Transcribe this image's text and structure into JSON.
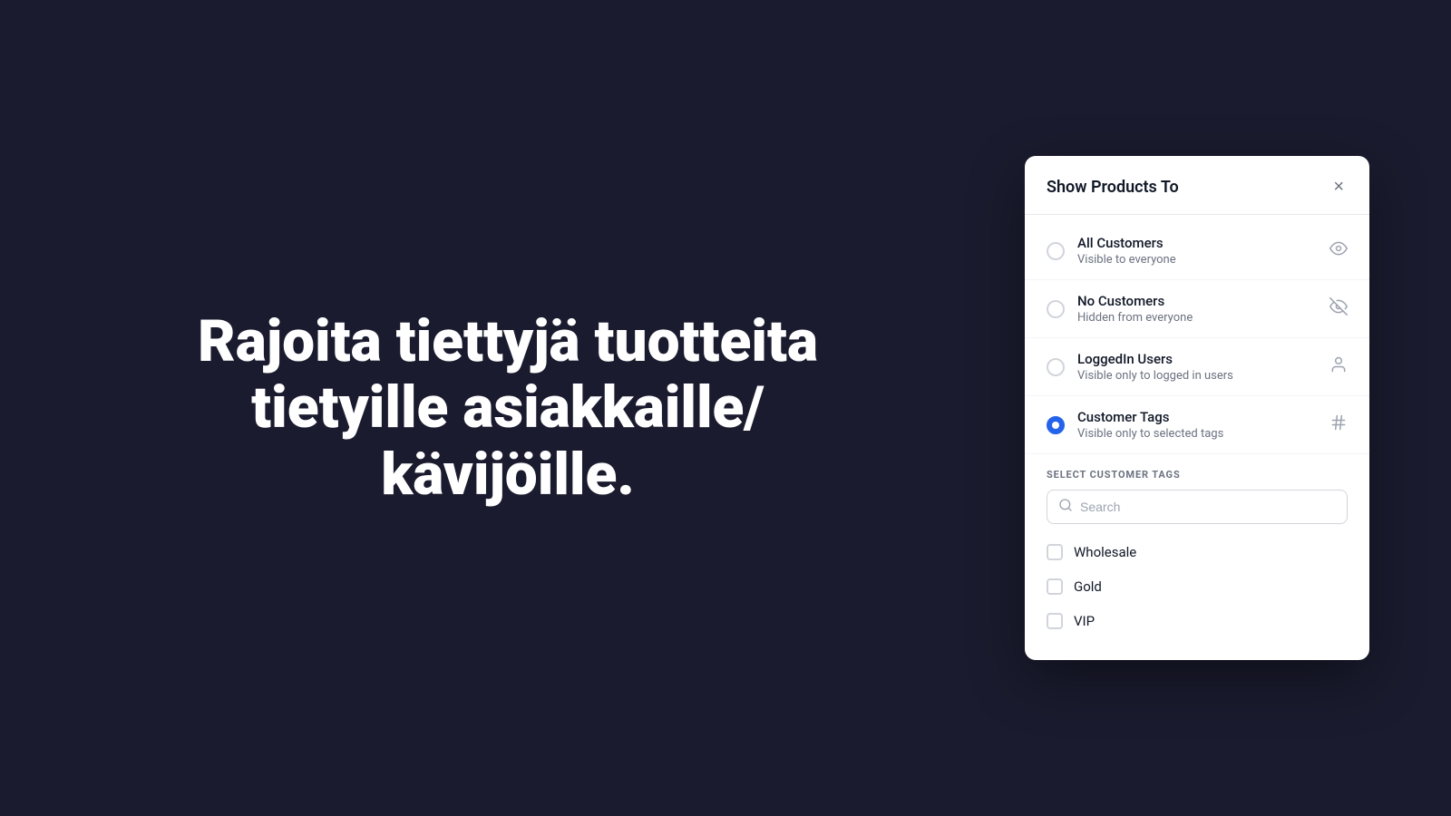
{
  "background": {
    "color": "#1a1b2e"
  },
  "hero": {
    "text": "Rajoita tiettyjä tuotteita tietyille asiakkaille/ kävijöille."
  },
  "modal": {
    "title": "Show Products To",
    "close_label": "×",
    "options": [
      {
        "id": "all-customers",
        "label": "All Customers",
        "description": "Visible to everyone",
        "icon": "👁",
        "checked": false
      },
      {
        "id": "no-customers",
        "label": "No Customers",
        "description": "Hidden from everyone",
        "icon": "🚫👁",
        "checked": false
      },
      {
        "id": "loggedin-users",
        "label": "LoggedIn Users",
        "description": "Visible only to logged in users",
        "icon": "👤",
        "checked": false
      },
      {
        "id": "customer-tags",
        "label": "Customer Tags",
        "description": "Visible only to selected tags",
        "icon": "#",
        "checked": true
      }
    ],
    "tags_section": {
      "label": "SELECT CUSTOMER TAGS",
      "search_placeholder": "Search",
      "tags": [
        {
          "id": "wholesale",
          "label": "Wholesale",
          "checked": false
        },
        {
          "id": "gold",
          "label": "Gold",
          "checked": false
        },
        {
          "id": "vip",
          "label": "VIP",
          "checked": false
        }
      ]
    }
  }
}
